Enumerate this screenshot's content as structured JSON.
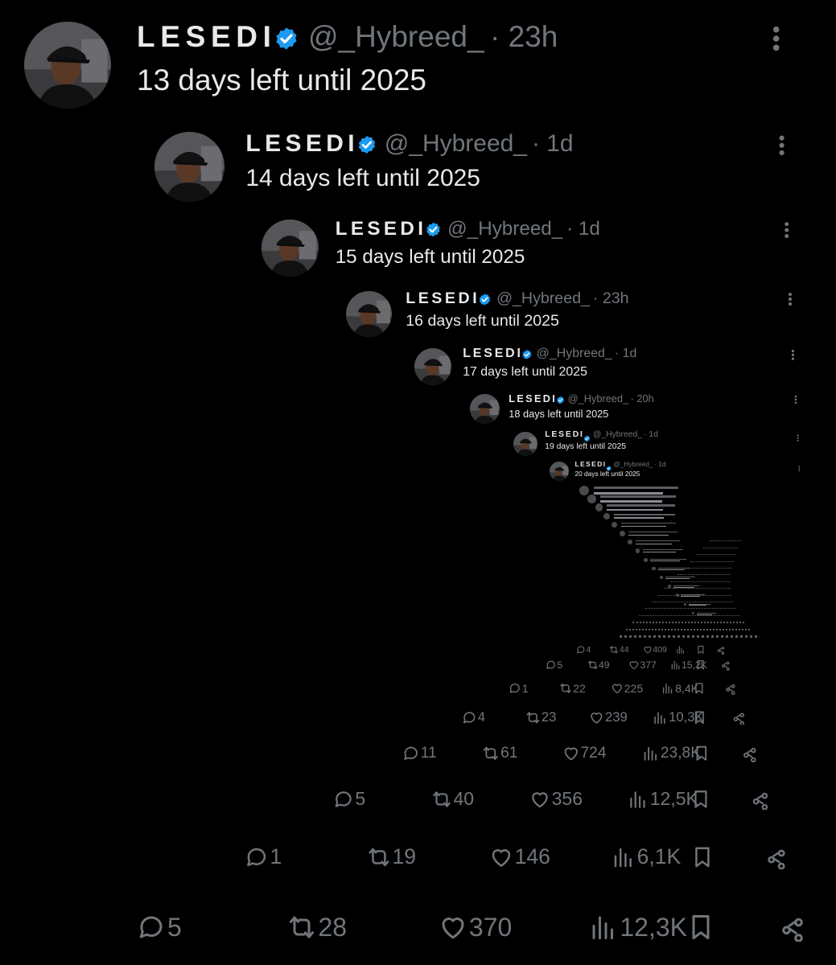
{
  "theme": {
    "background": "#000000",
    "text": "#e7e9ea",
    "muted": "#71767b",
    "verified": "#1d9bf0"
  },
  "tweets": [
    {
      "name": "LESEDI",
      "verified": true,
      "handle": "@_Hybreed_",
      "time": "· 23h",
      "text": "13 days left until 2025",
      "replies": "5",
      "reposts": "28",
      "likes": "370",
      "views": "12,3K"
    },
    {
      "name": "LESEDI",
      "verified": true,
      "handle": "@_Hybreed_",
      "time": "· 1d",
      "text": "14 days left until 2025",
      "replies": "1",
      "reposts": "19",
      "likes": "146",
      "views": "6,1K"
    },
    {
      "name": "LESEDI",
      "verified": true,
      "handle": "@_Hybreed_",
      "time": "· 1d",
      "text": "15 days left until 2025",
      "replies": "5",
      "reposts": "40",
      "likes": "356",
      "views": "12,5K"
    },
    {
      "name": "LESEDI",
      "verified": true,
      "handle": "@_Hybreed_",
      "time": "· 23h",
      "text": "16 days left until 2025",
      "replies": "11",
      "reposts": "61",
      "likes": "724",
      "views": "23,8K"
    },
    {
      "name": "LESEDI",
      "verified": true,
      "handle": "@_Hybreed_",
      "time": "· 1d",
      "text": "17 days left until 2025",
      "replies": "4",
      "reposts": "23",
      "likes": "239",
      "views": "10,3K"
    },
    {
      "name": "LESEDI",
      "verified": true,
      "handle": "@_Hybreed_",
      "time": "· 20h",
      "text": "18 days left until 2025",
      "replies": "1",
      "reposts": "22",
      "likes": "225",
      "views": "8,4K"
    },
    {
      "name": "LESEDI",
      "verified": true,
      "handle": "@_Hybreed_",
      "time": "· 1d",
      "text": "19 days left until 2025",
      "replies": "5",
      "reposts": "49",
      "likes": "377",
      "views": "15,2K"
    },
    {
      "name": "LESEDI",
      "verified": true,
      "handle": "@_Hybreed_",
      "time": "· 1d",
      "text": "20 days left until 2025",
      "replies": "4",
      "reposts": "44",
      "likes": "409",
      "views": ""
    }
  ],
  "icons": {
    "reply": "reply-icon",
    "repost": "repost-icon",
    "like": "heart-icon",
    "views": "views-chart-icon",
    "bookmark": "bookmark-icon",
    "share": "share-icon",
    "more": "more-options-icon",
    "verified": "verified-badge-icon"
  }
}
